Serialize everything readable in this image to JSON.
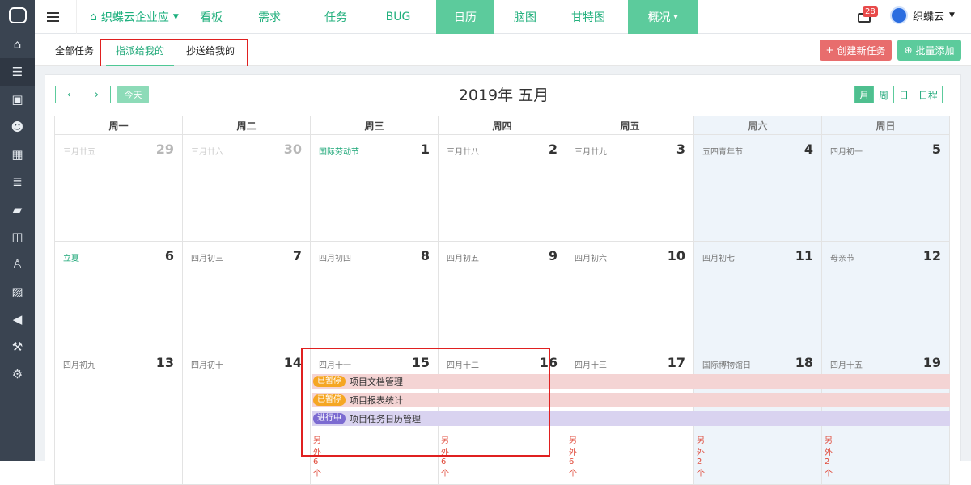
{
  "sidebar": {
    "icons": [
      "home-icon",
      "list-icon",
      "briefcase-icon",
      "users-icon",
      "calendar-icon",
      "server-icon",
      "book-icon",
      "columns-icon",
      "person-icon",
      "image-icon",
      "megaphone-icon",
      "gavel-icon",
      "cogs-icon"
    ]
  },
  "topbar": {
    "project": "织蝶云企业应",
    "nav": [
      "看板",
      "需求",
      "任务",
      "BUG",
      "日历",
      "脑图",
      "甘特图",
      "概况"
    ],
    "active_nav": "日历",
    "mail_badge": "28",
    "user": "织蝶云"
  },
  "subbar": {
    "tabs": [
      "全部任务",
      "指派给我的",
      "抄送给我的"
    ],
    "active_tab": "指派给我的",
    "create_btn": "创建新任务",
    "batch_btn": "批量添加"
  },
  "calendar": {
    "title": "2019年 五月",
    "today_btn": "今天",
    "views": [
      "月",
      "周",
      "日",
      "日程"
    ],
    "active_view": "月",
    "weekdays": [
      "周一",
      "周二",
      "周三",
      "周四",
      "周五",
      "周六",
      "周日"
    ],
    "weeks": [
      [
        {
          "lunar": "三月廿五",
          "day": "29",
          "dim": true
        },
        {
          "lunar": "三月廿六",
          "day": "30",
          "dim": true
        },
        {
          "lunar": "国际劳动节",
          "day": "1",
          "fest": true
        },
        {
          "lunar": "三月廿八",
          "day": "2"
        },
        {
          "lunar": "三月廿九",
          "day": "3"
        },
        {
          "lunar": "五四青年节",
          "day": "4"
        },
        {
          "lunar": "四月初一",
          "day": "5"
        }
      ],
      [
        {
          "lunar": "立夏",
          "day": "6",
          "fest": true
        },
        {
          "lunar": "四月初三",
          "day": "7"
        },
        {
          "lunar": "四月初四",
          "day": "8"
        },
        {
          "lunar": "四月初五",
          "day": "9"
        },
        {
          "lunar": "四月初六",
          "day": "10"
        },
        {
          "lunar": "四月初七",
          "day": "11"
        },
        {
          "lunar": "母亲节",
          "day": "12"
        }
      ],
      [
        {
          "lunar": "四月初九",
          "day": "13"
        },
        {
          "lunar": "四月初十",
          "day": "14"
        },
        {
          "lunar": "四月十一",
          "day": "15"
        },
        {
          "lunar": "四月十二",
          "day": "16"
        },
        {
          "lunar": "四月十三",
          "day": "17"
        },
        {
          "lunar": "国际博物馆日",
          "day": "18"
        },
        {
          "lunar": "四月十五",
          "day": "19"
        }
      ]
    ],
    "events": [
      {
        "status": "已暂停",
        "status_color": "#f5a623",
        "name": "项目文档管理",
        "bg": "#f4d4d4"
      },
      {
        "status": "已暂停",
        "status_color": "#f5a623",
        "name": "项目报表统计",
        "bg": "#f4d4d4"
      },
      {
        "status": "进行中",
        "status_color": "#7c6bd1",
        "name": "项目任务日历管理",
        "bg": "#d9d3f0"
      }
    ],
    "more": [
      {
        "col": 2,
        "text": "另外 6 个"
      },
      {
        "col": 3,
        "text": "另外 6 个"
      },
      {
        "col": 4,
        "text": "另外 6 个"
      },
      {
        "col": 5,
        "text": "另外 2 个"
      },
      {
        "col": 6,
        "text": "另外 2 个"
      }
    ]
  }
}
